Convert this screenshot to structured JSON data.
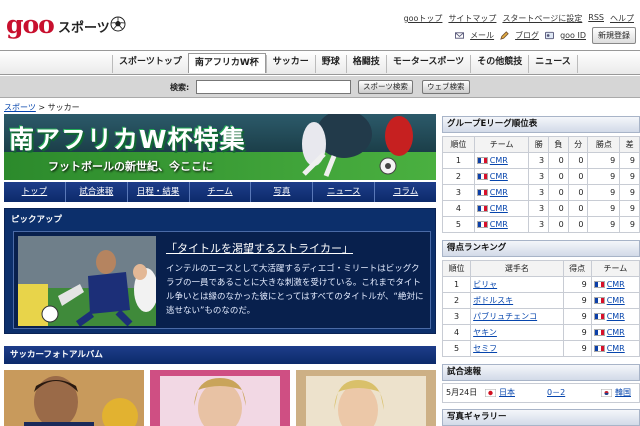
{
  "header": {
    "logo": "goo",
    "section": "スポーツ",
    "top_links": [
      "gooトップ",
      "サイトマップ",
      "スタートページに設定",
      "RSS",
      "ヘルプ"
    ],
    "tools": [
      "メール",
      "ブログ",
      "goo ID"
    ],
    "register_button": "新規登録"
  },
  "nav": {
    "items": [
      "スポーツトップ",
      "南アフリカW杯",
      "サッカー",
      "野球",
      "格闘技",
      "モータースポーツ",
      "その他競技",
      "ニュース"
    ],
    "active": "南アフリカW杯"
  },
  "search": {
    "label": "検索:",
    "value": "",
    "sports_button": "スポーツ検索",
    "web_button": "ウェブ検索"
  },
  "breadcrumb": {
    "home": "スポーツ",
    "sep": ">",
    "current": "サッカー"
  },
  "banner": {
    "title": "南アフリカW杯特集",
    "subtitle": "フットボールの新世紀、今ここに"
  },
  "banner_nav": [
    "トップ",
    "試合速報",
    "日程・結果",
    "チーム",
    "写真",
    "ニュース",
    "コラム"
  ],
  "pickup": {
    "header": "ピックアップ",
    "title": "「タイトルを渇望するストライカー」",
    "body": "インテルのエースとして大活躍するディエゴ・ミリートはビッグクラブの一員であることに大きな刺激を受けている。これまでタイトル争いとは縁のなかった彼にとってはすべてのタイトルが、“絶対に逃せない”ものなのだ。"
  },
  "photo_album": {
    "header": "サッカーフォトアルバム"
  },
  "standings": {
    "header": "グループEリーグ順位表",
    "columns": [
      "順位",
      "チーム",
      "勝",
      "負",
      "分",
      "勝点",
      "差"
    ],
    "rows": [
      {
        "rank": "1",
        "team": "CMR",
        "w": "3",
        "l": "0",
        "d": "0",
        "pts": "9",
        "diff": "9"
      },
      {
        "rank": "2",
        "team": "CMR",
        "w": "3",
        "l": "0",
        "d": "0",
        "pts": "9",
        "diff": "9"
      },
      {
        "rank": "3",
        "team": "CMR",
        "w": "3",
        "l": "0",
        "d": "0",
        "pts": "9",
        "diff": "9"
      },
      {
        "rank": "4",
        "team": "CMR",
        "w": "3",
        "l": "0",
        "d": "0",
        "pts": "9",
        "diff": "9"
      },
      {
        "rank": "5",
        "team": "CMR",
        "w": "3",
        "l": "0",
        "d": "0",
        "pts": "9",
        "diff": "9"
      }
    ]
  },
  "scorers": {
    "header": "得点ランキング",
    "columns": [
      "順位",
      "選手名",
      "得点",
      "チーム"
    ],
    "rows": [
      {
        "rank": "1",
        "player": "ビリャ",
        "goals": "9",
        "team": "CMR"
      },
      {
        "rank": "2",
        "player": "ポドルスキ",
        "goals": "9",
        "team": "CMR"
      },
      {
        "rank": "3",
        "player": "パブリュチェンコ",
        "goals": "9",
        "team": "CMR"
      },
      {
        "rank": "4",
        "player": "ヤキン",
        "goals": "9",
        "team": "CMR"
      },
      {
        "rank": "5",
        "player": "セミフ",
        "goals": "9",
        "team": "CMR"
      }
    ]
  },
  "results": {
    "header": "試合速報",
    "date": "5月24日",
    "home": "日本",
    "score": "0－2",
    "away": "韓国"
  },
  "gallery": {
    "header": "写真ギャラリー"
  }
}
